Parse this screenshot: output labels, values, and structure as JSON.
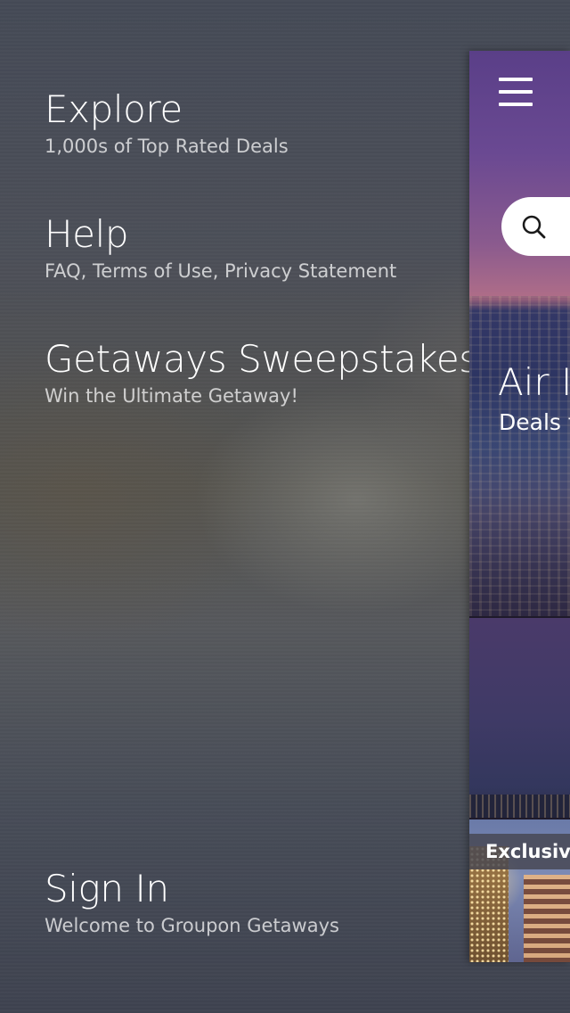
{
  "menu": {
    "items": [
      {
        "title": "Explore",
        "subtitle": "1,000s of Top Rated Deals"
      },
      {
        "title": "Help",
        "subtitle": "FAQ, Terms of Use, Privacy Statement"
      },
      {
        "title": "Getaways Sweepstakes",
        "subtitle": "Win the Ultimate Getaway!"
      }
    ],
    "sign_in": {
      "title": "Sign In",
      "subtitle": "Welcome to Groupon Getaways"
    }
  },
  "panel": {
    "menu_icon": "hamburger-menu-icon",
    "search_icon": "search-icon",
    "hero_title": "Air I",
    "hero_subtitle": "Deals f",
    "badge": "Exclusive"
  },
  "colors": {
    "text": "#ffffff",
    "badge_bg": "#46464f",
    "search_bg": "#ffffff"
  }
}
